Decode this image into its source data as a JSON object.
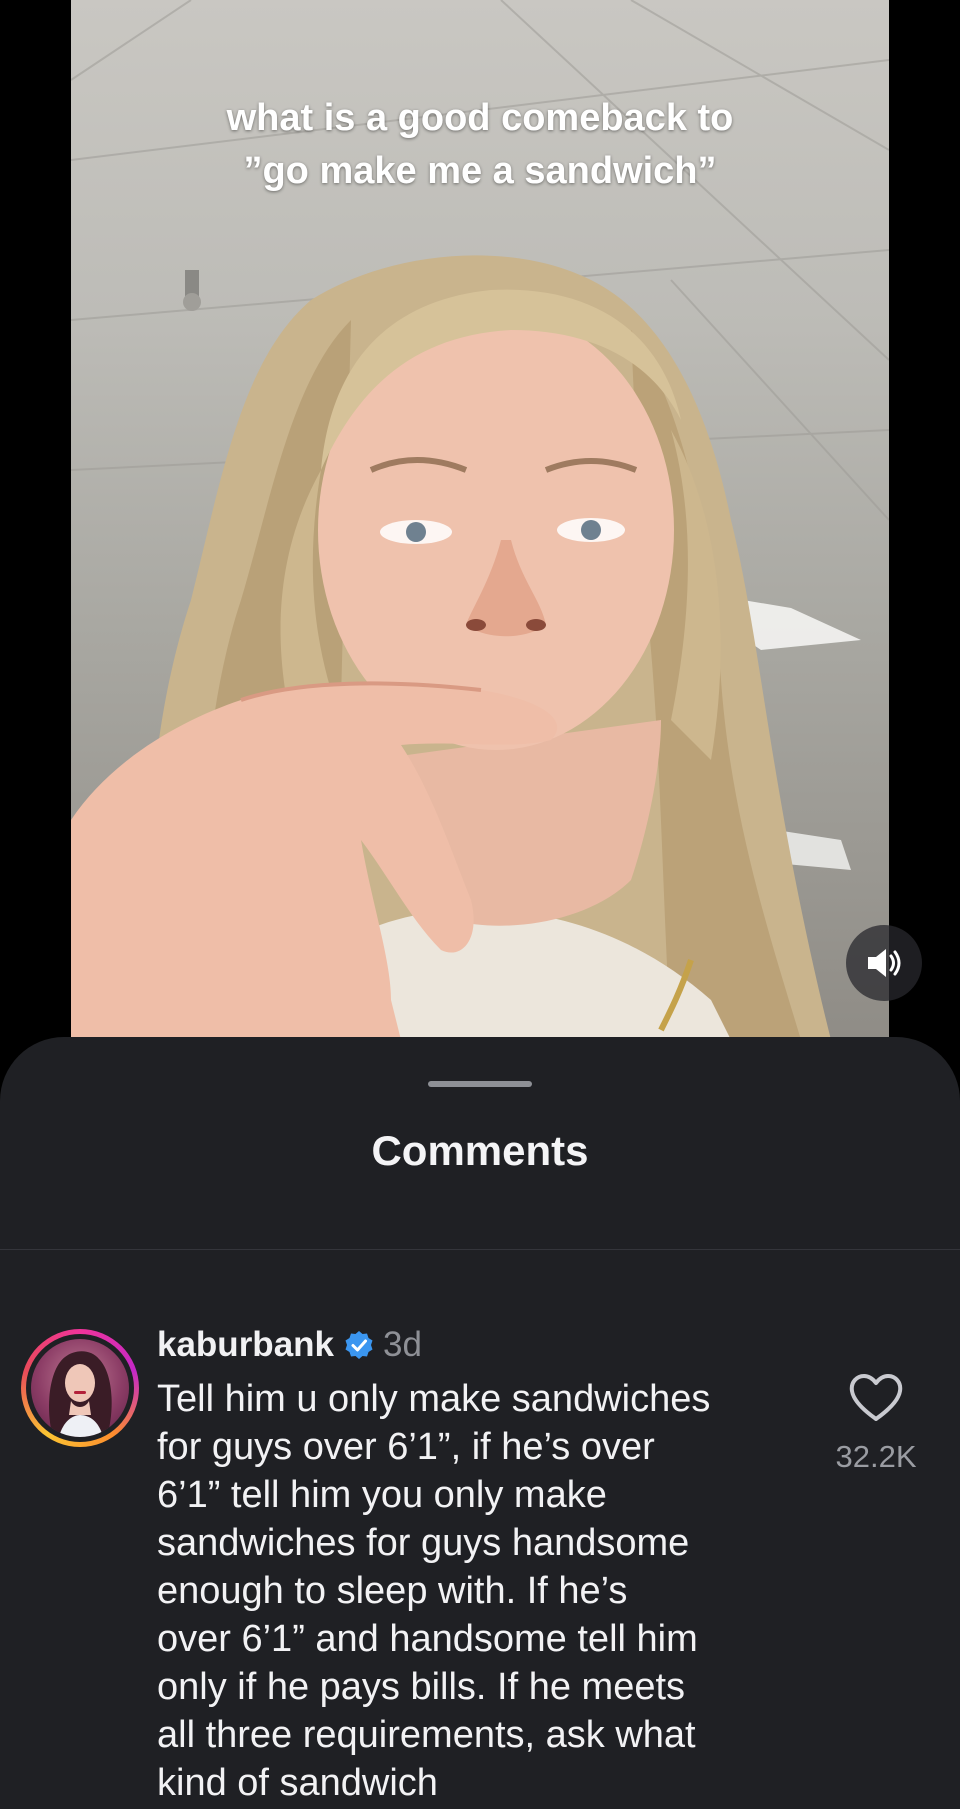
{
  "video": {
    "caption_lines": [
      "what is a good comeback to",
      "”go make me a sandwich”"
    ],
    "sound_icon": "speaker-icon"
  },
  "comments_sheet": {
    "title": "Comments",
    "comment": {
      "username": "kaburbank",
      "verified_icon": "verified-badge-icon",
      "time": "3d",
      "text_lines": [
        "Tell him u only make sandwiches",
        "for guys over 6’1”, if he’s over",
        "6’1” tell him you only make",
        "sandwiches for guys handsome",
        "enough to sleep with. If he’s",
        "over 6’1” and handsome tell him",
        "only if he pays bills. If he meets",
        "all three requirements, ask what",
        "kind of sandwich"
      ],
      "like_icon": "heart-icon",
      "like_count": "32.2K"
    }
  },
  "colors": {
    "sheet_background": "#1f2024",
    "text_primary": "#f2f2f4",
    "text_secondary": "#8e9096",
    "verified_blue": "#3b96f0"
  }
}
